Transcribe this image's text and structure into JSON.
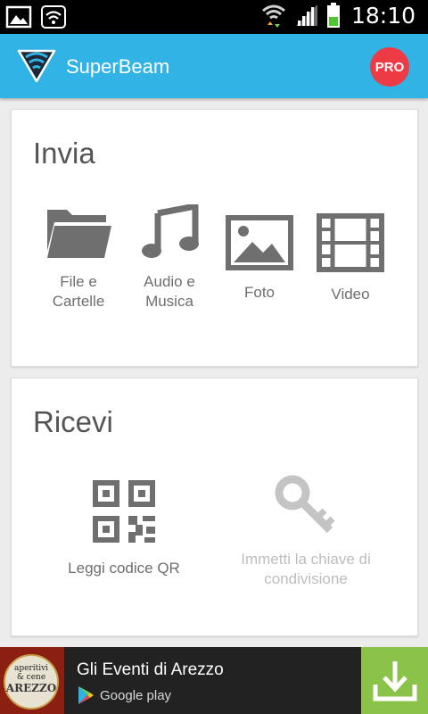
{
  "status_bar": {
    "time": "18:10",
    "icons": [
      "image-notification-icon",
      "wifi-notification-icon",
      "wifi-data-icon",
      "signal-icon",
      "battery-icon"
    ]
  },
  "app_bar": {
    "title": "SuperBeam",
    "pro_badge": "PRO",
    "accent_color": "#31b3e6",
    "badge_color": "#ee3a45"
  },
  "send_section": {
    "title": "Invia",
    "items": [
      {
        "label_line1": "File e",
        "label_line2": "Cartelle",
        "icon": "folder-icon"
      },
      {
        "label_line1": "Audio e",
        "label_line2": "Musica",
        "icon": "music-note-icon"
      },
      {
        "label": "Foto",
        "icon": "photo-icon"
      },
      {
        "label": "Video",
        "icon": "film-icon"
      }
    ]
  },
  "receive_section": {
    "title": "Ricevi",
    "items": [
      {
        "label": "Leggi codice QR",
        "icon": "qr-code-icon",
        "enabled": true
      },
      {
        "label_line1": "Immetti la chiave di",
        "label_line2": "condivisione",
        "icon": "key-icon",
        "enabled": false
      }
    ]
  },
  "ad_banner": {
    "title": "Gli Eventi di Arezzo",
    "store_label": "Google play",
    "thumb_line1": "aperitivi",
    "thumb_line2": "& cene",
    "thumb_line3": "AREZZO",
    "download_color": "#8bc34a"
  }
}
